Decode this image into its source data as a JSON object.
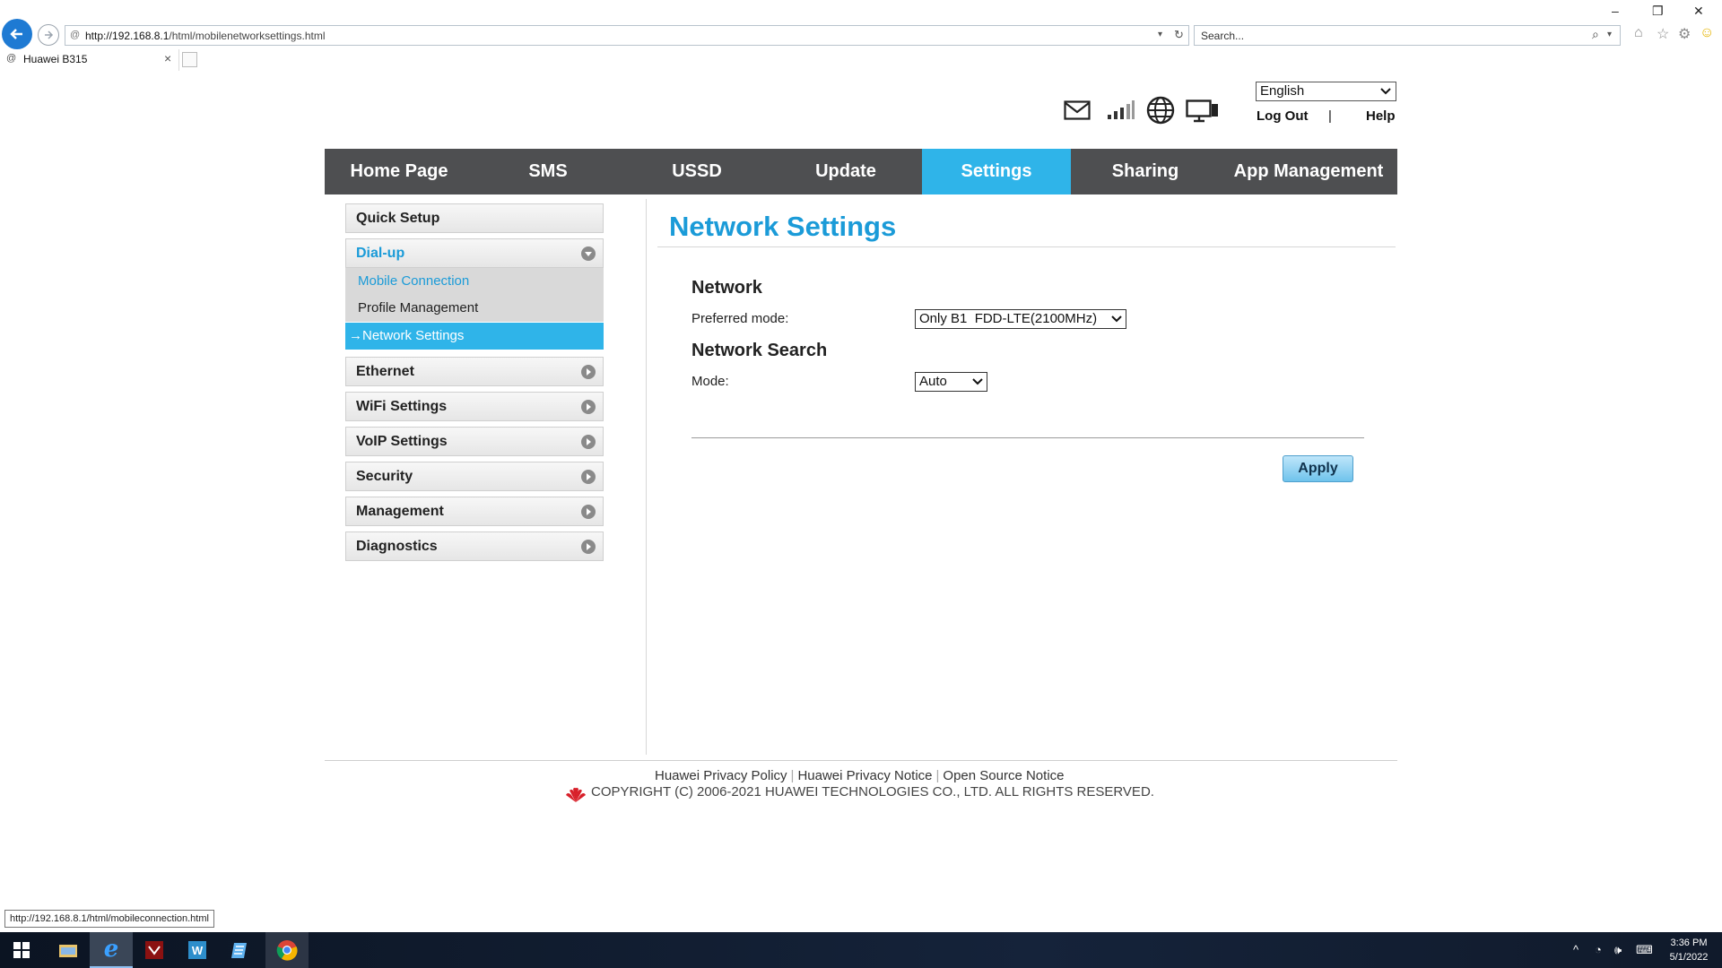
{
  "browser": {
    "url": "http://192.168.8.1/html/mobilenetworksettings.html",
    "url_host": "http://192.168.8.1",
    "url_path": "/html/mobilenetworksettings.html",
    "search_placeholder": "Search...",
    "tab_title": "Huawei B315",
    "status_url": "http://192.168.8.1/html/mobileconnection.html"
  },
  "header": {
    "language": "English",
    "logout_label": "Log Out",
    "separator": "|",
    "help_label": "Help",
    "icons": [
      "mail-icon",
      "signal-icon",
      "globe-icon",
      "devices-icon"
    ]
  },
  "menu": [
    {
      "label": "Home Page",
      "active": false
    },
    {
      "label": "SMS",
      "active": false
    },
    {
      "label": "USSD",
      "active": false
    },
    {
      "label": "Update",
      "active": false
    },
    {
      "label": "Settings",
      "active": true
    },
    {
      "label": "Sharing",
      "active": false
    },
    {
      "label": "App Management",
      "active": false
    }
  ],
  "sidebar": {
    "quick_setup": "Quick Setup",
    "dialup": "Dial-up",
    "dialup_children": [
      "Mobile Connection",
      "Profile Management",
      "Network Settings"
    ],
    "selected_arrow": "→",
    "items": [
      "Ethernet",
      "WiFi Settings",
      "VoIP Settings",
      "Security",
      "Management",
      "Diagnostics"
    ]
  },
  "main": {
    "title": "Network Settings",
    "network_section": "Network",
    "preferred_mode_label": "Preferred mode:",
    "preferred_mode_value": "Only B1  FDD-LTE(2100MHz)",
    "search_section": "Network Search",
    "mode_label": "Mode:",
    "mode_value": "Auto",
    "apply_label": "Apply"
  },
  "footer": {
    "links": [
      "Huawei Privacy Policy",
      "Huawei Privacy Notice",
      "Open Source Notice"
    ],
    "link_separator": "|",
    "copyright": "COPYRIGHT (C) 2006-2021 HUAWEI TECHNOLOGIES CO., LTD. ALL RIGHTS RESERVED."
  },
  "taskbar": {
    "time": "3:36 PM",
    "date": "5/1/2022",
    "apps": [
      "start-icon",
      "explorer-icon",
      "internet-explorer-icon",
      "pdf-reader-icon",
      "word-icon",
      "notepad-icon",
      "chrome-icon"
    ]
  },
  "colors": {
    "accent": "#2fb4e9",
    "title_blue": "#1b9bd8",
    "menubar": "#4e4f51"
  }
}
